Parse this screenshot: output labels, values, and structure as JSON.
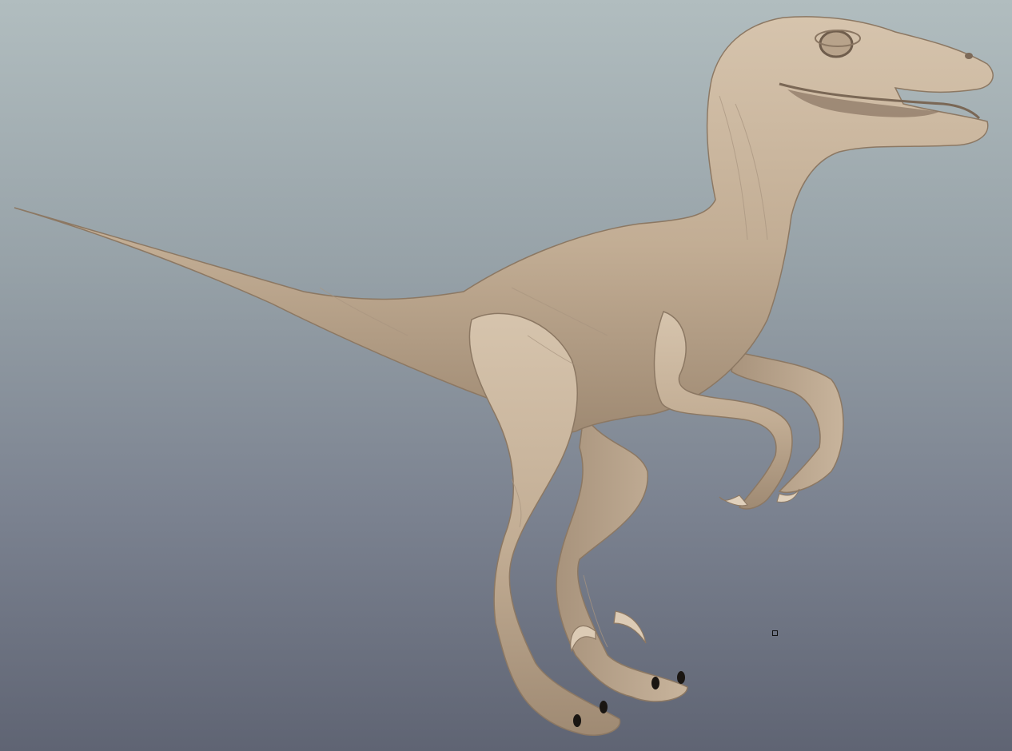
{
  "viewport": {
    "background_top": "#b1bdbf",
    "background_bottom": "#5f6473",
    "model_color": "#c7b299",
    "model_shadow": "#8e7b66",
    "model_highlight": "#dccbb5",
    "claw_color": "#1a1612"
  }
}
